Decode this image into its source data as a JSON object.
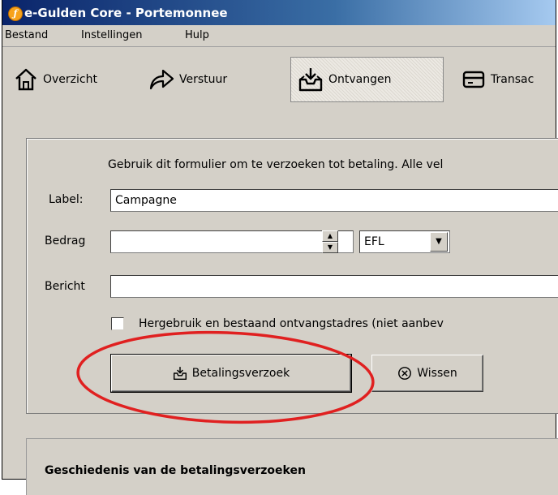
{
  "window": {
    "title": "e-Gulden Core - Portemonnee"
  },
  "menu": [
    "Bestand",
    "Instellingen",
    "Hulp"
  ],
  "toolbar": {
    "overview": "Overzicht",
    "send": "Verstuur",
    "receive": "Ontvangen",
    "transactions": "Transac"
  },
  "form": {
    "intro": "Gebruik dit formulier om te verzoeken tot betaling. Alle vel",
    "label_label": "Label:",
    "label_value": "Campagne",
    "amount_label": "Bedrag",
    "amount_value": "",
    "unit_value": "EFL",
    "message_label": "Bericht",
    "message_value": "",
    "reuse_label": "Hergebruik en bestaand ontvangstadres (niet aanbev",
    "request_button": "Betalingsverzoek",
    "clear_button": "Wissen"
  },
  "history": {
    "title": "Geschiedenis van de betalingsverzoeken"
  },
  "colors": {
    "titlebar": "#0a246a",
    "highlight_ellipse": "#e02020",
    "chrome": "#d4d0c8"
  }
}
